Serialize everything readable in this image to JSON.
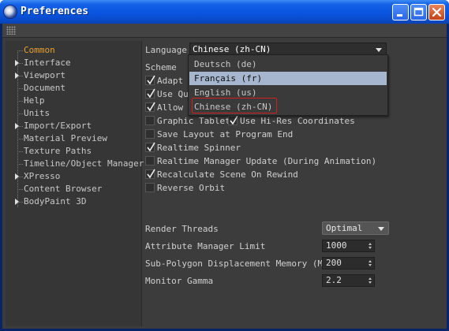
{
  "window": {
    "title": "Preferences"
  },
  "title_buttons": {
    "minimize": "minimize-icon",
    "maximize": "maximize-icon",
    "close": "close-icon"
  },
  "tree": [
    {
      "label": "Common",
      "active": true,
      "expandable": false
    },
    {
      "label": "Interface",
      "active": false,
      "expandable": true
    },
    {
      "label": "Viewport",
      "active": false,
      "expandable": true
    },
    {
      "label": "Document",
      "active": false,
      "expandable": false
    },
    {
      "label": "Help",
      "active": false,
      "expandable": false
    },
    {
      "label": "Units",
      "active": false,
      "expandable": false
    },
    {
      "label": "Import/Export",
      "active": false,
      "expandable": true
    },
    {
      "label": "Material Preview",
      "active": false,
      "expandable": false
    },
    {
      "label": "Texture Paths",
      "active": false,
      "expandable": false
    },
    {
      "label": "Timeline/Object Manager",
      "active": false,
      "expandable": false
    },
    {
      "label": "XPresso",
      "active": false,
      "expandable": true
    },
    {
      "label": "Content Browser",
      "active": false,
      "expandable": false
    },
    {
      "label": "BodyPaint 3D",
      "active": false,
      "expandable": true
    }
  ],
  "settings": {
    "language_label": "Language",
    "language_value": "Chinese (zh-CN)",
    "scheme_label": "Scheme",
    "checkboxes": [
      {
        "label": "Adapt ",
        "checked": true
      },
      {
        "label": "Use Qu",
        "checked": true
      },
      {
        "label": "Allow ",
        "checked": true
      },
      {
        "label": "Graphic Tablet",
        "checked": false
      },
      {
        "label": "Use Hi-Res Coordinates",
        "checked": true
      },
      {
        "label": "Save Layout at Program End",
        "checked": false
      },
      {
        "label": "Realtime Spinner",
        "checked": true
      },
      {
        "label": "Realtime Manager Update (During Animation)",
        "checked": false
      },
      {
        "label": "Recalculate Scene On Rewind",
        "checked": true
      },
      {
        "label": "Reverse Orbit",
        "checked": false
      }
    ],
    "render_threads_label": "Render Threads",
    "render_threads_value": "Optimal",
    "attr_limit_label": "Attribute Manager Limit",
    "attr_limit_value": "1000",
    "subpoly_label": "Sub-Polygon Displacement Memory (MB)",
    "subpoly_value": "200",
    "gamma_label": "Monitor Gamma",
    "gamma_value": "2.2"
  },
  "language_dropdown": {
    "options": [
      "Deutsch (de)",
      "Français (fr)",
      "English (us)",
      "Chinese (zh-CN)"
    ],
    "highlighted_index": 1
  },
  "colors": {
    "title_blue": "#0a55e0",
    "panel": "#3c3c3c",
    "active_item": "#e8a030",
    "highlight": "#a6b6cf"
  }
}
